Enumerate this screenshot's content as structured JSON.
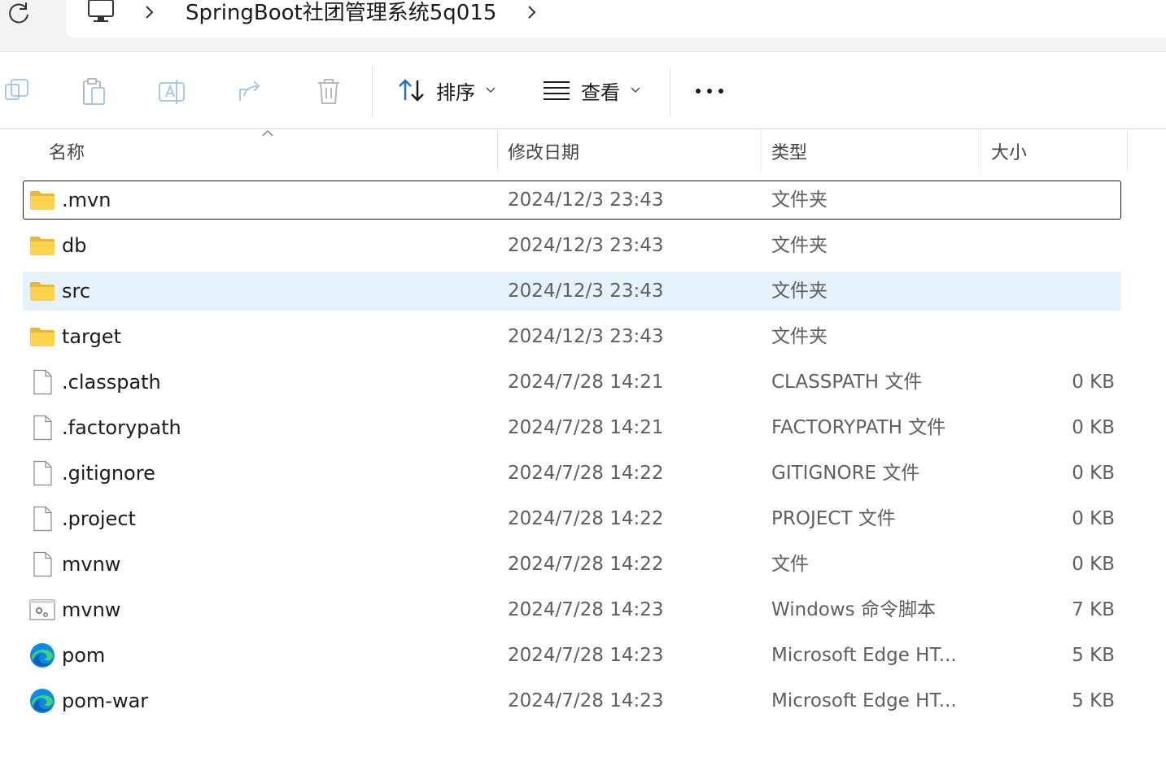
{
  "address": {
    "path": "SpringBoot社团管理系统5q015"
  },
  "toolbar": {
    "sort_label": "排序",
    "view_label": "查看"
  },
  "columns": {
    "name": "名称",
    "date": "修改日期",
    "type": "类型",
    "size": "大小"
  },
  "files": [
    {
      "name": ".mvn",
      "date": "2024/12/3 23:43",
      "type": "文件夹",
      "size": "",
      "icon": "folder-icon"
    },
    {
      "name": "db",
      "date": "2024/12/3 23:43",
      "type": "文件夹",
      "size": "",
      "icon": "folder-icon"
    },
    {
      "name": "src",
      "date": "2024/12/3 23:43",
      "type": "文件夹",
      "size": "",
      "icon": "folder-icon"
    },
    {
      "name": "target",
      "date": "2024/12/3 23:43",
      "type": "文件夹",
      "size": "",
      "icon": "folder-icon"
    },
    {
      "name": ".classpath",
      "date": "2024/7/28 14:21",
      "type": "CLASSPATH 文件",
      "size": "0 KB",
      "icon": "file-icon"
    },
    {
      "name": ".factorypath",
      "date": "2024/7/28 14:21",
      "type": "FACTORYPATH 文件",
      "size": "0 KB",
      "icon": "file-icon"
    },
    {
      "name": ".gitignore",
      "date": "2024/7/28 14:22",
      "type": "GITIGNORE 文件",
      "size": "0 KB",
      "icon": "file-icon"
    },
    {
      "name": ".project",
      "date": "2024/7/28 14:22",
      "type": "PROJECT 文件",
      "size": "0 KB",
      "icon": "file-icon"
    },
    {
      "name": "mvnw",
      "date": "2024/7/28 14:22",
      "type": "文件",
      "size": "0 KB",
      "icon": "file-icon"
    },
    {
      "name": "mvnw",
      "date": "2024/7/28 14:23",
      "type": "Windows 命令脚本",
      "size": "7 KB",
      "icon": "script-icon"
    },
    {
      "name": "pom",
      "date": "2024/7/28 14:23",
      "type": "Microsoft Edge HT...",
      "size": "5 KB",
      "icon": "edge-icon"
    },
    {
      "name": "pom-war",
      "date": "2024/7/28 14:23",
      "type": "Microsoft Edge HT...",
      "size": "5 KB",
      "icon": "edge-icon"
    }
  ],
  "state": {
    "focused_row": ".mvn",
    "selected_row": "src"
  }
}
